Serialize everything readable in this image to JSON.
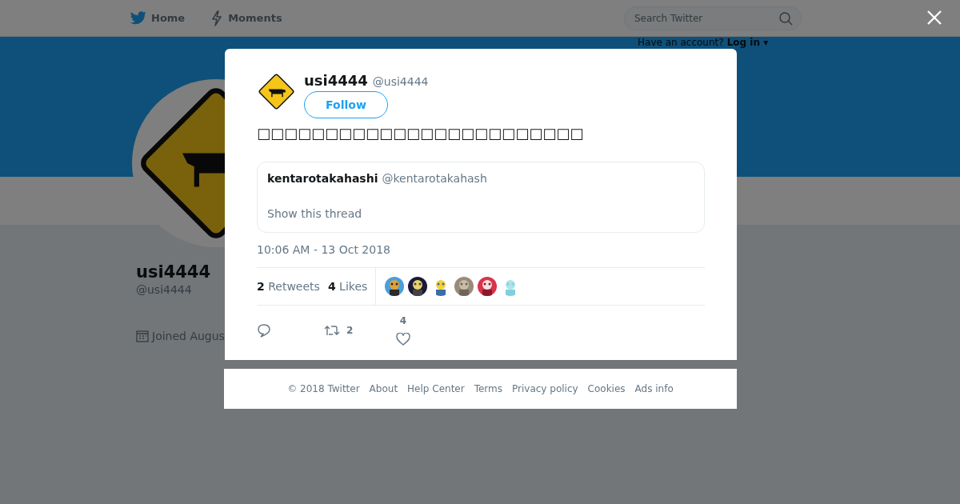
{
  "nav": {
    "items": [
      {
        "kind": "home",
        "label": "Home"
      },
      {
        "kind": "moments",
        "label": "Moments"
      }
    ],
    "search": {
      "placeholder": "Search Twitter"
    },
    "account_prompt": "Have an account?",
    "login": "Log in",
    "login_caret": "▾"
  },
  "profile": {
    "name": "usi4444",
    "handle": "@usi4444",
    "joined": "Joined Augus"
  },
  "modal": {
    "author": {
      "name": "usi4444",
      "handle": "@usi4444"
    },
    "follow": "Follow",
    "text": "□□□□□□□□□□□□□□□□□□□□□□□□",
    "quoted": {
      "name": "kentarotakahashi",
      "handle": "@kentarotakahash",
      "link": "Show this thread"
    },
    "timestamp": "10:06 AM - 13 Oct 2018",
    "stats": [
      {
        "count": "2",
        "label": "Retweets"
      },
      {
        "count": "4",
        "label": "Likes"
      }
    ],
    "actions": [
      {
        "kind": "reply"
      },
      {
        "kind": "retweet",
        "count": "2"
      },
      {
        "kind": "like",
        "count": "4"
      }
    ]
  },
  "footer": [
    "© 2018 Twitter",
    "About",
    "Help Center",
    "Terms",
    "Privacy policy",
    "Cookies",
    "Ads info"
  ]
}
